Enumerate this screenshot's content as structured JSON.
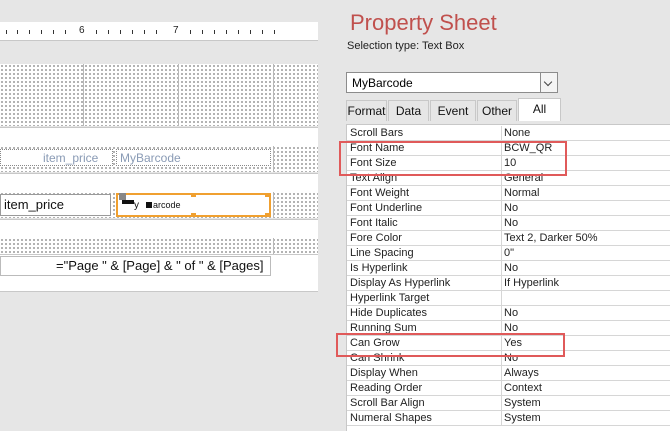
{
  "designer": {
    "ruler_numbers": [
      "6",
      "7"
    ],
    "field_label_price": "item_price",
    "field_label_barcode": "MyBarcode",
    "text_item_price": "item_price",
    "barcode_text": "arcode",
    "barcode_prefix": "y",
    "page_expr": "=\"Page \" & [Page] & \" of \" & [Pages]"
  },
  "property_sheet": {
    "title": "Property Sheet",
    "selection_type": "Selection type:  Text Box",
    "object": "MyBarcode",
    "tabs": [
      "Format",
      "Data",
      "Event",
      "Other",
      "All"
    ],
    "active_tab": "All",
    "rows": [
      {
        "name": "Scroll Bars",
        "value": "None"
      },
      {
        "name": "Font Name",
        "value": "BCW_QR"
      },
      {
        "name": "Font Size",
        "value": "10"
      },
      {
        "name": "Text Align",
        "value": "General"
      },
      {
        "name": "Font Weight",
        "value": "Normal"
      },
      {
        "name": "Font Underline",
        "value": "No"
      },
      {
        "name": "Font Italic",
        "value": "No"
      },
      {
        "name": "Fore Color",
        "value": "Text 2, Darker 50%"
      },
      {
        "name": "Line Spacing",
        "value": "0\""
      },
      {
        "name": "Is Hyperlink",
        "value": "No"
      },
      {
        "name": "Display As Hyperlink",
        "value": "If Hyperlink"
      },
      {
        "name": "Hyperlink Target",
        "value": ""
      },
      {
        "name": "Hide Duplicates",
        "value": "No"
      },
      {
        "name": "Running Sum",
        "value": "No"
      },
      {
        "name": "Can Grow",
        "value": "Yes"
      },
      {
        "name": "Can Shrink",
        "value": "No"
      },
      {
        "name": "Display When",
        "value": "Always"
      },
      {
        "name": "Reading Order",
        "value": "Context"
      },
      {
        "name": "Scroll Bar Align",
        "value": "System"
      },
      {
        "name": "Numeral Shapes",
        "value": "System"
      }
    ]
  },
  "colors": {
    "title": "#c0504d",
    "highlight": "#e05a5a",
    "selection": "#f0a030"
  }
}
